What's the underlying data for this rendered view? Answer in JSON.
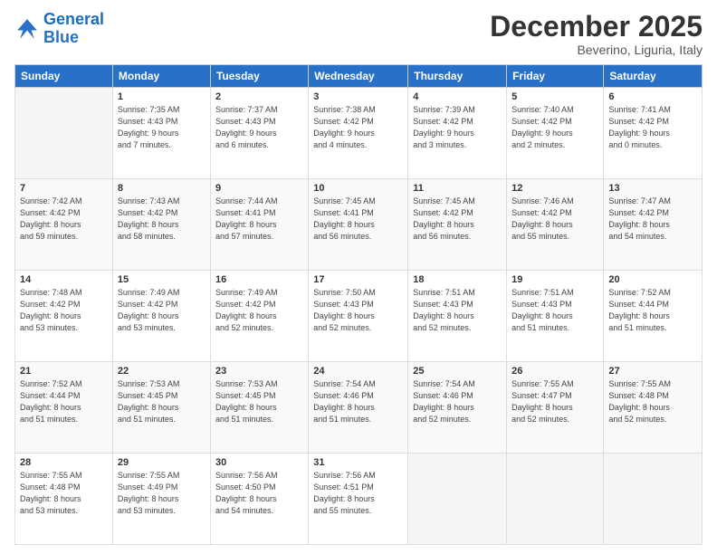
{
  "logo": {
    "line1": "General",
    "line2": "Blue"
  },
  "title": "December 2025",
  "location": "Beverino, Liguria, Italy",
  "days_header": [
    "Sunday",
    "Monday",
    "Tuesday",
    "Wednesday",
    "Thursday",
    "Friday",
    "Saturday"
  ],
  "weeks": [
    [
      {
        "day": "",
        "info": ""
      },
      {
        "day": "1",
        "info": "Sunrise: 7:35 AM\nSunset: 4:43 PM\nDaylight: 9 hours\nand 7 minutes."
      },
      {
        "day": "2",
        "info": "Sunrise: 7:37 AM\nSunset: 4:43 PM\nDaylight: 9 hours\nand 6 minutes."
      },
      {
        "day": "3",
        "info": "Sunrise: 7:38 AM\nSunset: 4:42 PM\nDaylight: 9 hours\nand 4 minutes."
      },
      {
        "day": "4",
        "info": "Sunrise: 7:39 AM\nSunset: 4:42 PM\nDaylight: 9 hours\nand 3 minutes."
      },
      {
        "day": "5",
        "info": "Sunrise: 7:40 AM\nSunset: 4:42 PM\nDaylight: 9 hours\nand 2 minutes."
      },
      {
        "day": "6",
        "info": "Sunrise: 7:41 AM\nSunset: 4:42 PM\nDaylight: 9 hours\nand 0 minutes."
      }
    ],
    [
      {
        "day": "7",
        "info": "Sunrise: 7:42 AM\nSunset: 4:42 PM\nDaylight: 8 hours\nand 59 minutes."
      },
      {
        "day": "8",
        "info": "Sunrise: 7:43 AM\nSunset: 4:42 PM\nDaylight: 8 hours\nand 58 minutes."
      },
      {
        "day": "9",
        "info": "Sunrise: 7:44 AM\nSunset: 4:41 PM\nDaylight: 8 hours\nand 57 minutes."
      },
      {
        "day": "10",
        "info": "Sunrise: 7:45 AM\nSunset: 4:41 PM\nDaylight: 8 hours\nand 56 minutes."
      },
      {
        "day": "11",
        "info": "Sunrise: 7:45 AM\nSunset: 4:42 PM\nDaylight: 8 hours\nand 56 minutes."
      },
      {
        "day": "12",
        "info": "Sunrise: 7:46 AM\nSunset: 4:42 PM\nDaylight: 8 hours\nand 55 minutes."
      },
      {
        "day": "13",
        "info": "Sunrise: 7:47 AM\nSunset: 4:42 PM\nDaylight: 8 hours\nand 54 minutes."
      }
    ],
    [
      {
        "day": "14",
        "info": "Sunrise: 7:48 AM\nSunset: 4:42 PM\nDaylight: 8 hours\nand 53 minutes."
      },
      {
        "day": "15",
        "info": "Sunrise: 7:49 AM\nSunset: 4:42 PM\nDaylight: 8 hours\nand 53 minutes."
      },
      {
        "day": "16",
        "info": "Sunrise: 7:49 AM\nSunset: 4:42 PM\nDaylight: 8 hours\nand 52 minutes."
      },
      {
        "day": "17",
        "info": "Sunrise: 7:50 AM\nSunset: 4:43 PM\nDaylight: 8 hours\nand 52 minutes."
      },
      {
        "day": "18",
        "info": "Sunrise: 7:51 AM\nSunset: 4:43 PM\nDaylight: 8 hours\nand 52 minutes."
      },
      {
        "day": "19",
        "info": "Sunrise: 7:51 AM\nSunset: 4:43 PM\nDaylight: 8 hours\nand 51 minutes."
      },
      {
        "day": "20",
        "info": "Sunrise: 7:52 AM\nSunset: 4:44 PM\nDaylight: 8 hours\nand 51 minutes."
      }
    ],
    [
      {
        "day": "21",
        "info": "Sunrise: 7:52 AM\nSunset: 4:44 PM\nDaylight: 8 hours\nand 51 minutes."
      },
      {
        "day": "22",
        "info": "Sunrise: 7:53 AM\nSunset: 4:45 PM\nDaylight: 8 hours\nand 51 minutes."
      },
      {
        "day": "23",
        "info": "Sunrise: 7:53 AM\nSunset: 4:45 PM\nDaylight: 8 hours\nand 51 minutes."
      },
      {
        "day": "24",
        "info": "Sunrise: 7:54 AM\nSunset: 4:46 PM\nDaylight: 8 hours\nand 51 minutes."
      },
      {
        "day": "25",
        "info": "Sunrise: 7:54 AM\nSunset: 4:46 PM\nDaylight: 8 hours\nand 52 minutes."
      },
      {
        "day": "26",
        "info": "Sunrise: 7:55 AM\nSunset: 4:47 PM\nDaylight: 8 hours\nand 52 minutes."
      },
      {
        "day": "27",
        "info": "Sunrise: 7:55 AM\nSunset: 4:48 PM\nDaylight: 8 hours\nand 52 minutes."
      }
    ],
    [
      {
        "day": "28",
        "info": "Sunrise: 7:55 AM\nSunset: 4:48 PM\nDaylight: 8 hours\nand 53 minutes."
      },
      {
        "day": "29",
        "info": "Sunrise: 7:55 AM\nSunset: 4:49 PM\nDaylight: 8 hours\nand 53 minutes."
      },
      {
        "day": "30",
        "info": "Sunrise: 7:56 AM\nSunset: 4:50 PM\nDaylight: 8 hours\nand 54 minutes."
      },
      {
        "day": "31",
        "info": "Sunrise: 7:56 AM\nSunset: 4:51 PM\nDaylight: 8 hours\nand 55 minutes."
      },
      {
        "day": "",
        "info": ""
      },
      {
        "day": "",
        "info": ""
      },
      {
        "day": "",
        "info": ""
      }
    ]
  ]
}
